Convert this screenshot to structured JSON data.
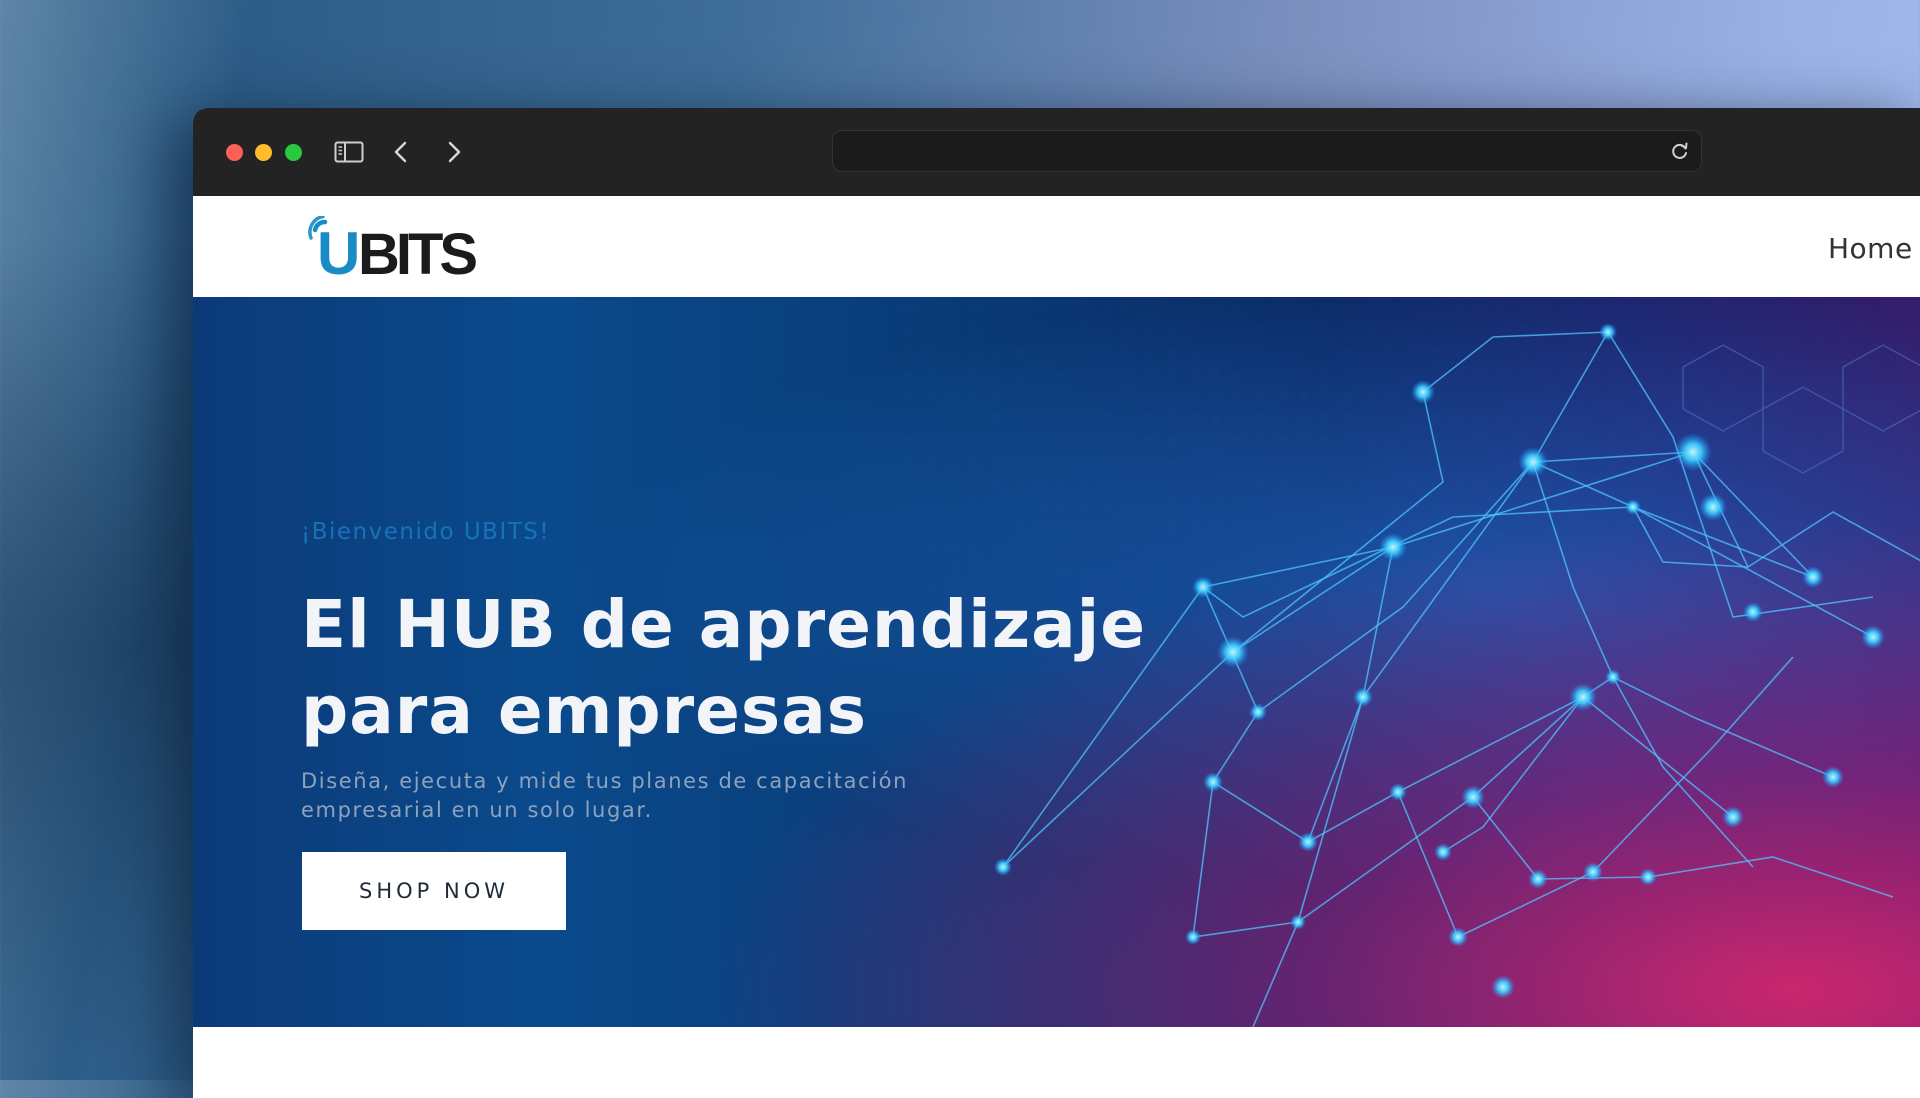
{
  "browser": {
    "url": "",
    "icons": [
      "sidebar-icon",
      "chevron-left-icon",
      "chevron-right-icon",
      "reload-icon"
    ]
  },
  "site": {
    "logo_text": "UBITS",
    "nav": {
      "home_label": "Home"
    }
  },
  "hero": {
    "eyebrow": "¡Bienvenido UBITS!",
    "title": "El HUB de aprendizaje para empresas",
    "subtitle": "Diseña, ejecuta y mide tus planes de capacitación empresarial en un solo lugar.",
    "cta_label": "SHOP NOW"
  },
  "colors": {
    "logo_blue": "#1a8bc4",
    "logo_dark": "#1b1b1b",
    "hero_eyebrow": "#1673b8",
    "hero_title": "#f2f4f8"
  }
}
